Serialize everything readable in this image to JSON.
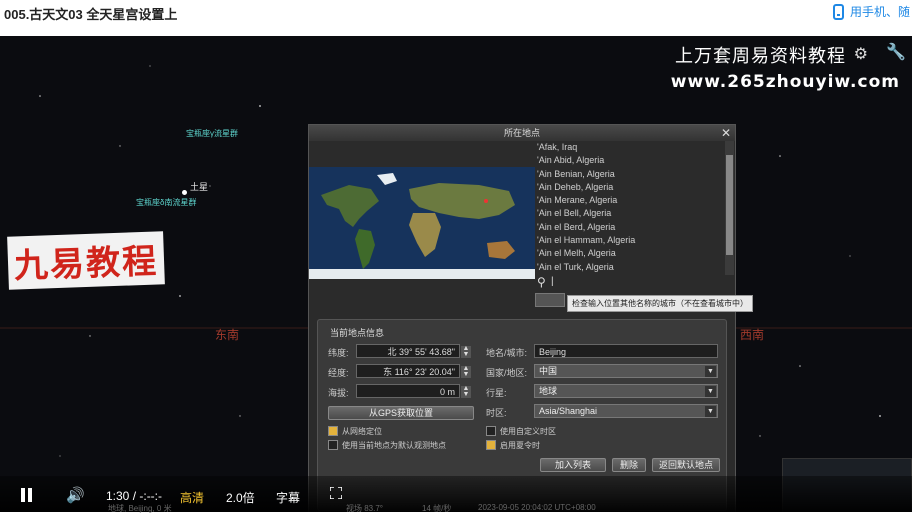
{
  "page": {
    "title": "005.古天文03 全天星宫设置上",
    "mobile_link": "用手机、随"
  },
  "video": {
    "watermark_text": "上万套周易资料教程",
    "watermark_url": "www.265zhouyiw.com",
    "brand_logo": "九易教程",
    "sky": {
      "star_label_1": "宝瓶座γ流星群",
      "star_label_2": "宝瓶座δ南流星群",
      "saturn_label": "土星",
      "southeast": "东南",
      "southwest": "西南"
    },
    "dialog": {
      "title": "所在地点",
      "close": "✕",
      "cities": [
        "'Afak, Iraq",
        "'Ain Abid, Algeria",
        "'Ain Benian, Algeria",
        "'Ain Deheb, Algeria",
        "'Ain Merane, Algeria",
        "'Ain el Bell, Algeria",
        "'Ain el Berd, Algeria",
        "'Ain el Hammam, Algeria",
        "'Ain el Melh, Algeria",
        "'Ain el Turk, Algeria"
      ],
      "search_value": "|",
      "tooltip": "检查输入位置其他名称的城市（不在查看城市中）",
      "panel_title": "当前地点信息",
      "latitude_label": "纬度:",
      "latitude_value": "北 39° 55' 43.68\"",
      "longitude_label": "经度:",
      "longitude_value": "东 116° 23' 20.04\"",
      "altitude_label": "海拔:",
      "altitude_value": "0 m",
      "gps_button": "从GPS获取位置",
      "name_label": "地名/城市:",
      "name_value": "Beijing",
      "country_label": "国家/地区:",
      "country_value": "中国",
      "planet_label": "行星:",
      "planet_value": "地球",
      "timezone_label": "时区:",
      "timezone_value": "Asia/Shanghai",
      "check_network": "从网络定位",
      "check_use_as_default": "使用当前地点为默认观测地点",
      "check_custom_tz": "使用自定义时区",
      "check_dst": "启用夏令时",
      "add_button": "加入列表",
      "delete_button": "删除",
      "reset_button": "返回默认地点"
    },
    "status_underlay": {
      "location": "地球, Beijing, 0 米",
      "fov": "视场 83.7°",
      "fps": "14 帧/秒",
      "datetime": "2023-09-05 20:04:02 UTC+08:00"
    }
  },
  "controls": {
    "time": "1:30 / -:--:-",
    "quality": "高清",
    "speed": "2.0倍",
    "subtitle": "字幕"
  }
}
